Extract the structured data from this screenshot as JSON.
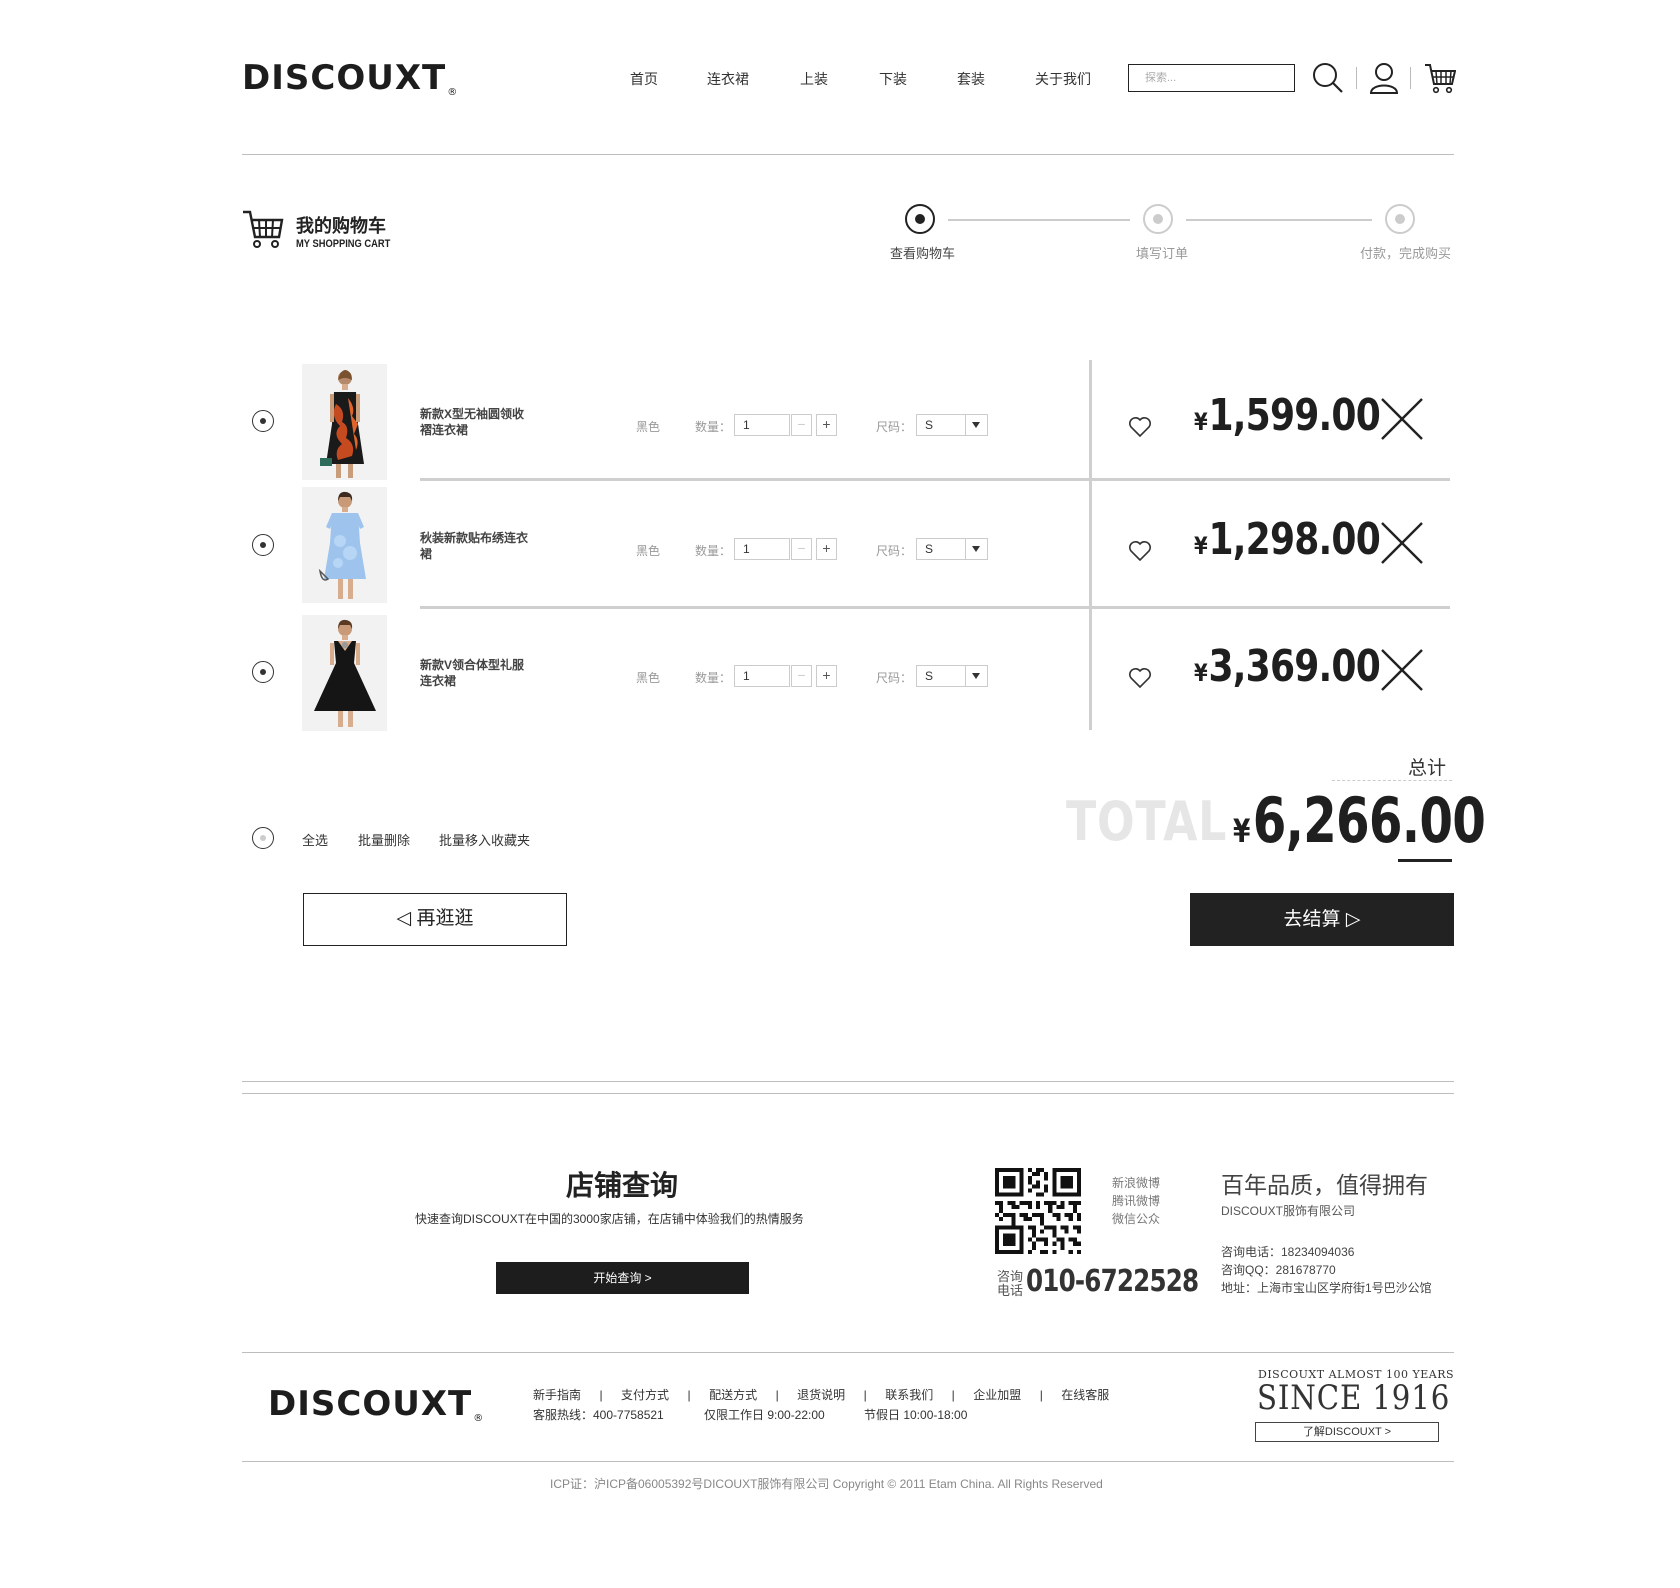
{
  "brand": {
    "logo": "DISCOUXT",
    "reg": "®"
  },
  "nav": {
    "items": [
      "首页",
      "连衣裙",
      "上装",
      "下装",
      "套装",
      "关于我们"
    ]
  },
  "search": {
    "placeholder": "探索..."
  },
  "cart_header": {
    "title_cn": "我的购物车",
    "title_en": "MY SHOPPING CART"
  },
  "steps": [
    {
      "label": "查看购物车",
      "active": true
    },
    {
      "label": "填写订单",
      "active": false
    },
    {
      "label": "付款，完成购买",
      "active": false
    }
  ],
  "items": [
    {
      "name": "新款X型无袖圆领收褶连衣裙",
      "color": "黑色",
      "qty_label": "数量：",
      "qty": "1",
      "size_label": "尺码：",
      "size": "S",
      "currency": "¥",
      "price": "1,599.00",
      "minus": "−",
      "plus": "+"
    },
    {
      "name": "秋装新款贴布绣连衣裙",
      "color": "黑色",
      "qty_label": "数量：",
      "qty": "1",
      "size_label": "尺码：",
      "size": "S",
      "currency": "¥",
      "price": "1,298.00",
      "minus": "−",
      "plus": "+"
    },
    {
      "name": "新款V领合体型礼服连衣裙",
      "color": "黑色",
      "qty_label": "数量：",
      "qty": "1",
      "size_label": "尺码：",
      "size": "S",
      "currency": "¥",
      "price": "3,369.00",
      "minus": "−",
      "plus": "+"
    }
  ],
  "batch": {
    "select_all": "全选",
    "delete": "批量删除",
    "favorite": "批量移入收藏夹"
  },
  "total": {
    "label": "总计",
    "ghost": "TOTAL",
    "currency": "¥",
    "value": "6,266.00"
  },
  "buttons": {
    "continue": "◁ 再逛逛",
    "checkout": "去结算 ▷"
  },
  "footer": {
    "store_title": "店铺查询",
    "store_desc": "快速查询DISCOUXT在中国的3000家店铺，在店铺中体验我们的热情服务",
    "store_btn": "开始查询 >",
    "social": [
      "新浪微博",
      "腾讯微博",
      "微信公众"
    ],
    "hotline_label_1": "咨询",
    "hotline_label_2": "电话",
    "hotline": "010-6722528",
    "slogan": "百年品质，值得拥有",
    "company": "DISCOUXT服饰有限公司",
    "phone": "咨询电话：18234094036",
    "qq": "咨询QQ：281678770",
    "address": "地址：上海市宝山区学府街1号巴沙公馆",
    "links": [
      "新手指南",
      "支付方式",
      "配送方式",
      "退货说明",
      "联系我们",
      "企业加盟",
      "在线客服"
    ],
    "link_sep": "|",
    "service_hotline": "客服热线：400-7758521",
    "work_hours": "仅限工作日 9:00-22:00",
    "holiday_hours": "节假日 10:00-18:00",
    "since_small": "DISCOUXT ALMOST 100 YEARS",
    "since_big": "SINCE 1916",
    "since_btn": "了解DISCOUXT >",
    "copyright": "ICP证：沪ICP备06005392号DICOUXT服饰有限公司 Copyright © 2011 Etam China. All Rights Reserved"
  },
  "colors": {
    "text": "#222222",
    "muted": "#999999",
    "divider": "#cfcfcf",
    "button_dark": "#222222"
  }
}
